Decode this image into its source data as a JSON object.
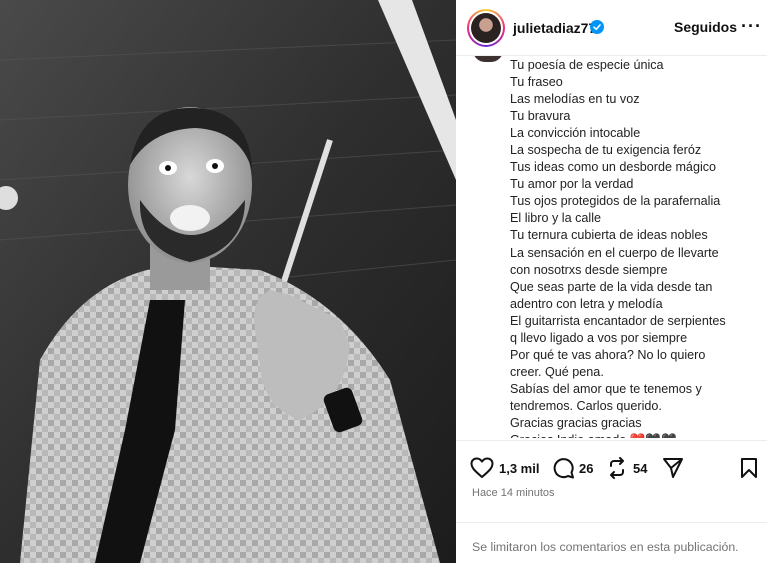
{
  "post": {
    "photo_alt": "Foto en blanco y negro de un músico con camisa a cuadros y corbata"
  },
  "header": {
    "username": "julietadiaz77",
    "follow_status": "Seguidos",
    "more_label": "···"
  },
  "caption": {
    "lines": [
      "Tu poesía de especie única",
      "Tu fraseo",
      "Las melodías en tu voz",
      "Tu bravura",
      "La convicción intocable",
      "La sospecha de tu exigencia feróz",
      "Tus ideas como un desborde mágico",
      "Tu amor por la verdad",
      "Tus ojos protegidos de la parafernalia",
      "El libro y la calle",
      "Tu ternura cubierta de ideas nobles",
      "La sensación en el cuerpo de llevarte",
      "con nosotrxs desde siempre",
      "Que seas parte de la vida desde tan",
      "adentro con letra y melodía",
      "El guitarrista encantador de serpientes",
      "q llevo ligado a vos por siempre",
      "Por qué te vas ahora? No lo quiero",
      "creer. Qué pena.",
      "Sabías del amor que te tenemos y",
      "tendremos. Carlos querido.",
      "Gracias gracias gracias",
      "Gracias Indio amado ❤️🖤🖤"
    ]
  },
  "actions": {
    "likes": "1,3 mil",
    "comments": "26",
    "reposts": "54"
  },
  "timestamp": "Hace 14 minutos",
  "comments_notice": "Se limitaron los comentarios en esta publicación.",
  "colors": {
    "verified": "#0095f6",
    "muted_text": "#737373",
    "divider": "#ececec"
  }
}
